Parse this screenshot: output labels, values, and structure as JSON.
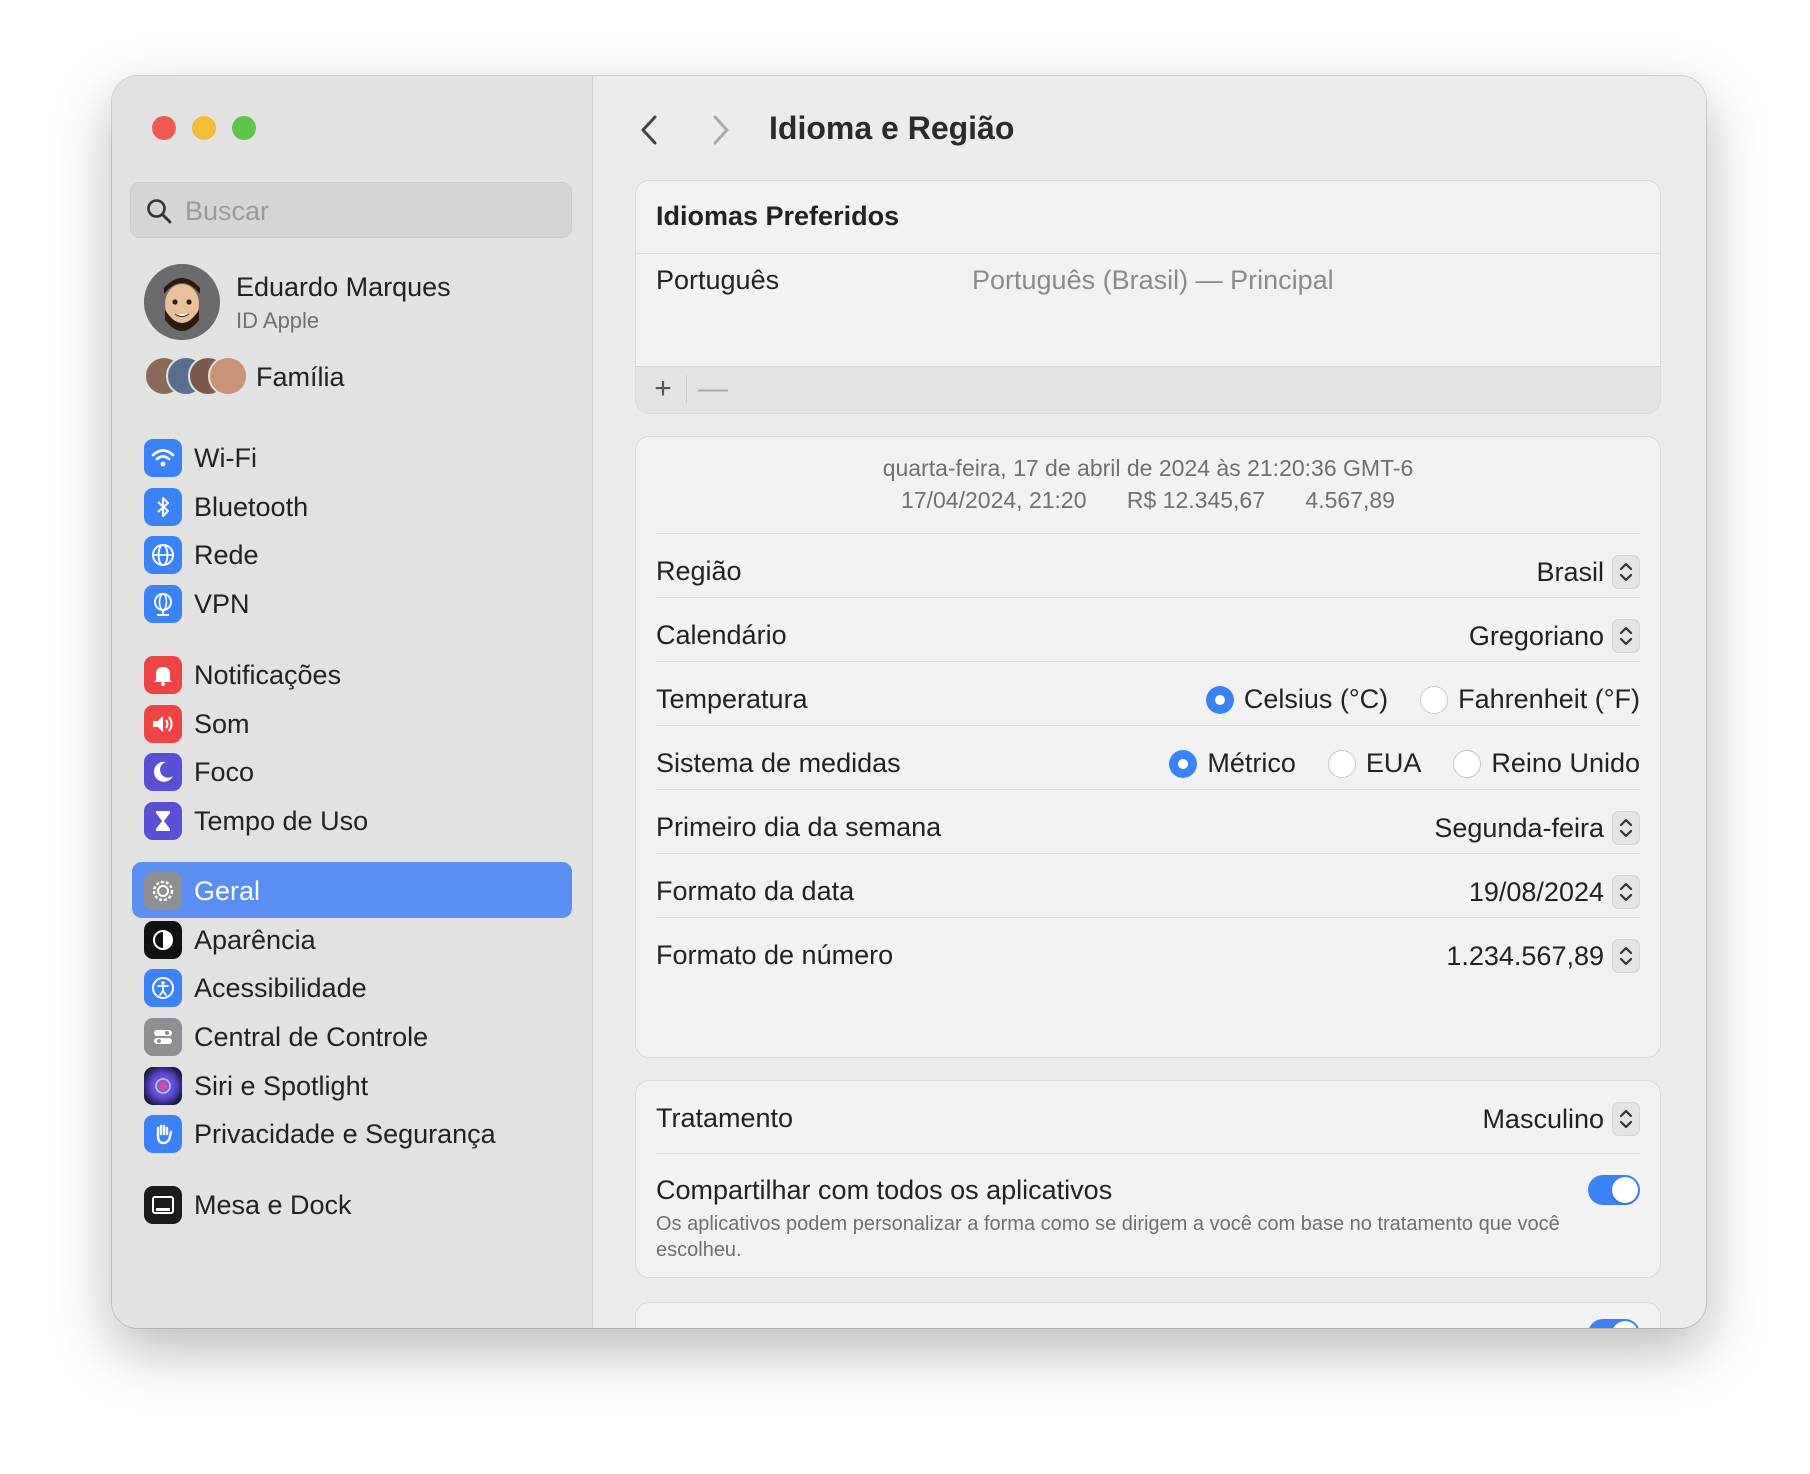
{
  "sidebar": {
    "search_placeholder": "Buscar",
    "account": {
      "name": "Eduardo Marques",
      "subtitle": "ID Apple"
    },
    "family_label": "Família",
    "items": [
      {
        "id": "wifi",
        "label": "Wi-Fi",
        "icon": "wifi-icon",
        "color": "#3b82f6"
      },
      {
        "id": "bluetooth",
        "label": "Bluetooth",
        "icon": "bluetooth-icon",
        "color": "#3b82f6"
      },
      {
        "id": "rede",
        "label": "Rede",
        "icon": "globe-icon",
        "color": "#3b82f6"
      },
      {
        "id": "vpn",
        "label": "VPN",
        "icon": "vpn-globe-icon",
        "color": "#3b82f6"
      },
      {
        "id": "notificacoes",
        "label": "Notificações",
        "icon": "bell-icon",
        "color": "#ef4444"
      },
      {
        "id": "som",
        "label": "Som",
        "icon": "speaker-icon",
        "color": "#ef4444"
      },
      {
        "id": "foco",
        "label": "Foco",
        "icon": "moon-icon",
        "color": "#5b4fd6"
      },
      {
        "id": "tempo-de-uso",
        "label": "Tempo de Uso",
        "icon": "hourglass-icon",
        "color": "#5b4fd6"
      },
      {
        "id": "geral",
        "label": "Geral",
        "icon": "gear-icon",
        "color": "#8e8e93",
        "active": true
      },
      {
        "id": "aparencia",
        "label": "Aparência",
        "icon": "appearance-icon",
        "color": "#111111"
      },
      {
        "id": "acessibilidade",
        "label": "Acessibilidade",
        "icon": "accessibility-icon",
        "color": "#3b82f6"
      },
      {
        "id": "central-de-controle",
        "label": "Central de Controle",
        "icon": "control-center-icon",
        "color": "#8e8e93"
      },
      {
        "id": "siri-spotlight",
        "label": "Siri e Spotlight",
        "icon": "siri-icon",
        "color": "#222244"
      },
      {
        "id": "privacidade",
        "label": "Privacidade e Segurança",
        "icon": "hand-icon",
        "color": "#3b82f6"
      },
      {
        "id": "mesa-dock",
        "label": "Mesa e Dock",
        "icon": "dock-icon",
        "color": "#1c1c1e"
      }
    ]
  },
  "main": {
    "title": "Idioma e Região",
    "preferred_languages": {
      "heading": "Idiomas Preferidos",
      "language": "Português",
      "description": "Português (Brasil) — Principal",
      "add_label": "+",
      "remove_label": "—"
    },
    "preview": {
      "line1": "quarta-feira, 17 de abril de 2024 às 21:20:36 GMT-6",
      "date_time": "17/04/2024, 21:20",
      "currency": "R$ 12.345,67",
      "number": "4.567,89"
    },
    "region": {
      "regiao": {
        "label": "Região",
        "value": "Brasil"
      },
      "calendario": {
        "label": "Calendário",
        "value": "Gregoriano"
      },
      "temperatura": {
        "label": "Temperatura",
        "options": [
          "Celsius (°C)",
          "Fahrenheit (°F)"
        ],
        "selected": "Celsius (°C)"
      },
      "medidas": {
        "label": "Sistema de medidas",
        "options": [
          "Métrico",
          "EUA",
          "Reino Unido"
        ],
        "selected": "Métrico"
      },
      "primeiro_dia": {
        "label": "Primeiro dia da semana",
        "value": "Segunda-feira"
      },
      "formato_data": {
        "label": "Formato da data",
        "value": "19/08/2024"
      },
      "formato_numero": {
        "label": "Formato de número",
        "value": "1.234.567,89"
      }
    },
    "treatment": {
      "label": "Tratamento",
      "value": "Masculino",
      "share_title": "Compartilhar com todos os aplicativos",
      "share_desc": "Os aplicativos podem personalizar a forma como se dirigem a você com base no tratamento que você escolheu.",
      "share_enabled": true
    }
  },
  "colors": {
    "accent": "#3a82f6",
    "selection": "#5a8ef0"
  }
}
